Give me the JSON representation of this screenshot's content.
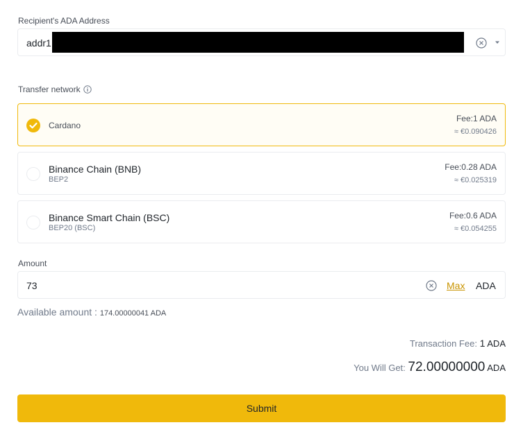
{
  "recipient": {
    "label": "Recipient's ADA Address",
    "value_visible": "addr1"
  },
  "network": {
    "label": "Transfer network",
    "options": [
      {
        "name": "Cardano",
        "sub": "",
        "fee": "Fee:1 ADA",
        "eur": "≈ €0.090426",
        "selected": true
      },
      {
        "name": "Binance Chain (BNB)",
        "sub": "BEP2",
        "fee": "Fee:0.28 ADA",
        "eur": "≈ €0.025319",
        "selected": false
      },
      {
        "name": "Binance Smart Chain (BSC)",
        "sub": "BEP20 (BSC)",
        "fee": "Fee:0.6 ADA",
        "eur": "≈ €0.054255",
        "selected": false
      }
    ]
  },
  "amount": {
    "label": "Amount",
    "value": "73",
    "max_label": "Max",
    "unit": "ADA",
    "available_label": "Available amount :",
    "available_value": "174.00000041 ADA"
  },
  "summary": {
    "fee_label": "Transaction Fee:",
    "fee_value": "1",
    "fee_unit": "ADA",
    "get_label": "You Will Get:",
    "get_value": "72.00000000",
    "get_unit": "ADA"
  },
  "submit_label": "Submit",
  "colors": {
    "accent": "#f0b90b",
    "link": "#c99400",
    "border": "#eaecef"
  }
}
